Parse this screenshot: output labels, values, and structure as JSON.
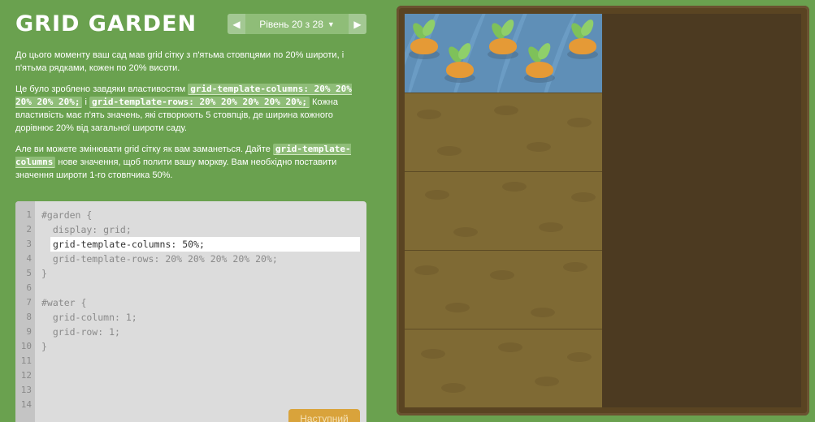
{
  "app": {
    "title": "GRID GARDEN"
  },
  "level_nav": {
    "prev_icon": "◀",
    "next_icon": "▶",
    "label": "Рівень 20 з 28",
    "caret": "▼"
  },
  "instructions": {
    "p1": "До цього моменту ваш сад мав grid сітку з п'ятьма стовпцями по 20% широти, і п'ятьма рядками, кожен по 20% висоти.",
    "p2_start": "Це було зроблено завдяки властивостям ",
    "p2_code1": "grid-template-columns: 20% 20% 20% 20% 20%;",
    "p2_mid": " і ",
    "p2_code2": "grid-template-rows: 20% 20% 20% 20% 20%;",
    "p2_end": " Кожна властивість має п'ять значень, які створюють 5 стовпців, де ширина кожного дорівнює 20% від загальної широти саду.",
    "p3_start": "Але ви можете змінювати grid сітку як вам заманеться. Дайте ",
    "p3_code": "grid-template-columns",
    "p3_end": " нове значення, щоб полити вашу моркву. Вам необхідно поставити значення широти 1-го стовпчика 50%."
  },
  "editor": {
    "lines": [
      {
        "num": "1",
        "code": "#garden {"
      },
      {
        "num": "2",
        "code": "  display: grid;"
      },
      {
        "num": "3",
        "code": ""
      },
      {
        "num": "4",
        "code": "  grid-template-rows: 20% 20% 20% 20% 20%;"
      },
      {
        "num": "5",
        "code": "}"
      },
      {
        "num": "6",
        "code": ""
      },
      {
        "num": "7",
        "code": "#water {"
      },
      {
        "num": "8",
        "code": "  grid-column: 1;"
      },
      {
        "num": "9",
        "code": "  grid-row: 1;"
      },
      {
        "num": "10",
        "code": "}"
      },
      {
        "num": "11",
        "code": ""
      },
      {
        "num": "12",
        "code": ""
      },
      {
        "num": "13",
        "code": ""
      },
      {
        "num": "14",
        "code": ""
      }
    ],
    "input_value": "grid-template-columns: 50%;"
  },
  "next_button": {
    "label": "Наступний"
  },
  "colors": {
    "background": "#6aa14f",
    "water": "#5f8fb7",
    "soil": "#7f6a34",
    "carrot": "#e59a36",
    "next_button": "#d9a33b"
  }
}
